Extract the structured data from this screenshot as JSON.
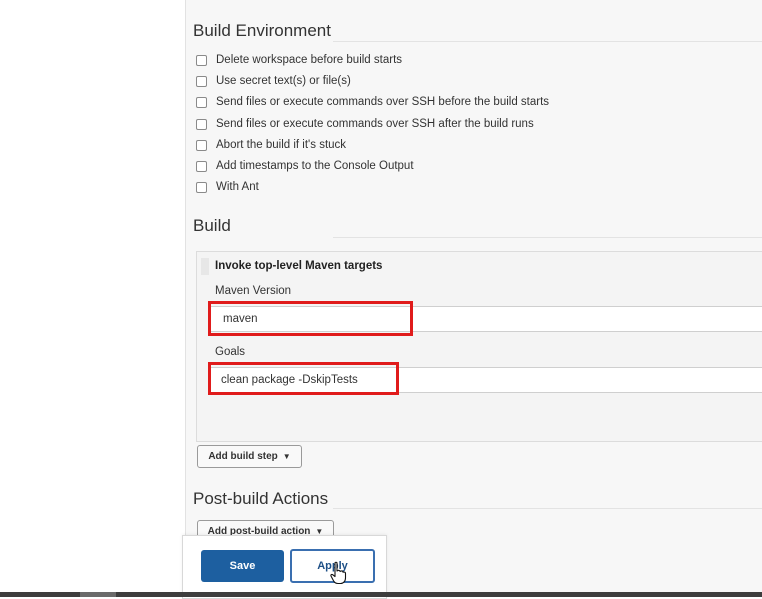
{
  "build_environment": {
    "title": "Build Environment",
    "options": [
      {
        "label": "Delete workspace before build starts",
        "checked": false
      },
      {
        "label": "Use secret text(s) or file(s)",
        "checked": false
      },
      {
        "label": "Send files or execute commands over SSH before the build starts",
        "checked": false
      },
      {
        "label": "Send files or execute commands over SSH after the build runs",
        "checked": false
      },
      {
        "label": "Abort the build if it's stuck",
        "checked": false
      },
      {
        "label": "Add timestamps to the Console Output",
        "checked": false
      },
      {
        "label": "With Ant",
        "checked": false
      }
    ]
  },
  "build": {
    "title": "Build",
    "step": {
      "title": "Invoke top-level Maven targets",
      "maven_version_label": "Maven Version",
      "maven_version_value": "maven",
      "goals_label": "Goals",
      "goals_value": "clean package -DskipTests"
    },
    "add_step_label": "Add build step"
  },
  "post_build": {
    "title": "Post-build Actions",
    "add_action_label": "Add post-build action"
  },
  "footer": {
    "save_label": "Save",
    "apply_label": "Apply"
  },
  "colors": {
    "primary": "#1d5fa0",
    "highlight": "#e01b1b"
  }
}
